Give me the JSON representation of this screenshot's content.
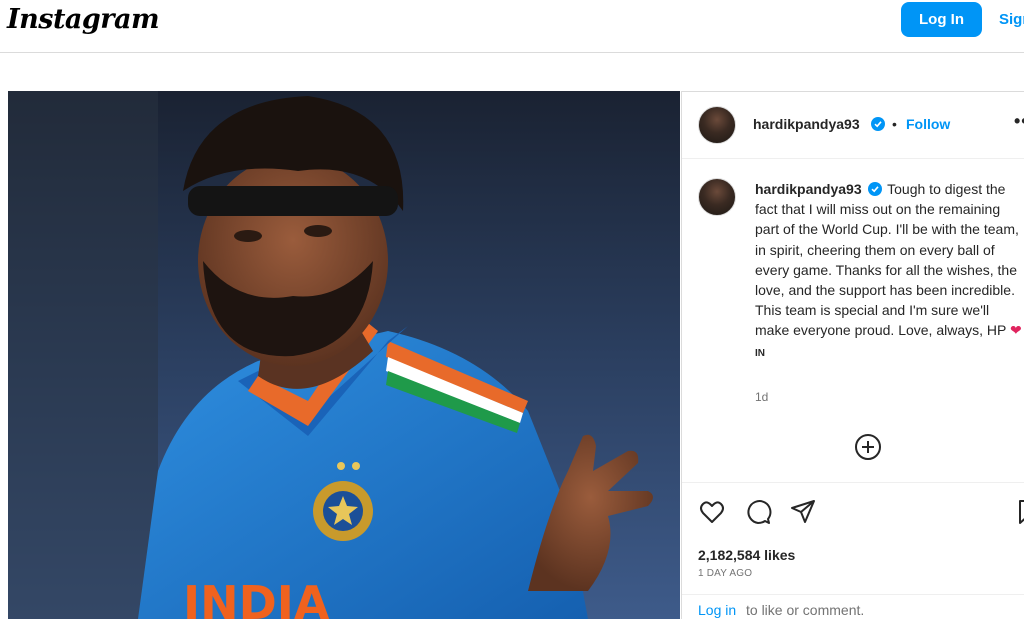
{
  "app": {
    "logo_text": "Instagram",
    "login_label": "Log In",
    "signup_label": "Sign Up"
  },
  "post": {
    "username": "hardikpandya93",
    "follow_label": "Follow",
    "dot": "•",
    "more_icon": "more-options-icon",
    "caption": {
      "username": "hardikpandya93",
      "text": "Tough to digest the fact that I will miss out on the remaining part of the World Cup. I'll be with the team, in spirit, cheering them on every ball of every game. Thanks for all the wishes, the love, and the support has been incredible. This team is special and I'm sure we'll make everyone proud. Love, always, HP",
      "heart": "❤",
      "flag": "IN"
    },
    "time_ago": "1d",
    "likes": "2,182,584 likes",
    "posted_ago": "1 DAY AGO",
    "login_link": "Log in",
    "login_rest": "to like or comment.",
    "image_text": "INDIA"
  },
  "colors": {
    "accent": "#0095f6",
    "verified": "#0095f6",
    "jersey": "#1f7fd6"
  },
  "icons": [
    "verified-badge-icon",
    "add-comment-icon",
    "like-heart-icon",
    "comment-icon",
    "share-icon",
    "bookmark-icon"
  ]
}
